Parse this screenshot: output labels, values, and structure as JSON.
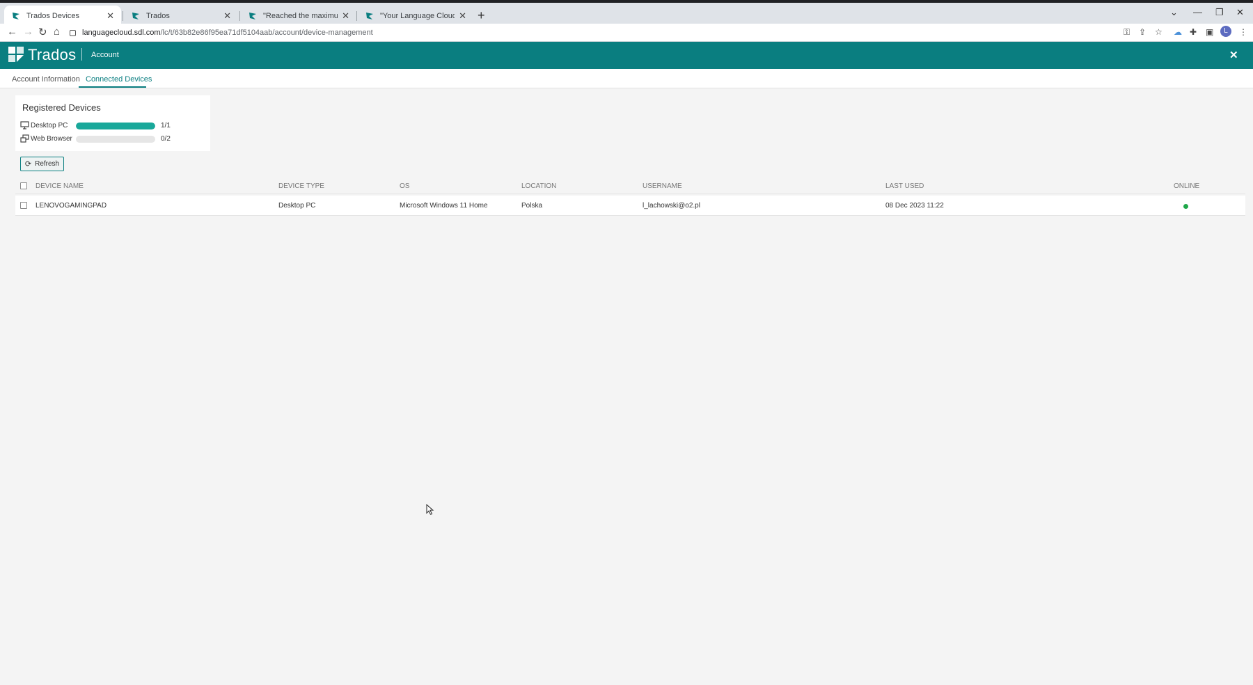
{
  "browser": {
    "tabs": [
      {
        "title": "Trados Devices",
        "active": true
      },
      {
        "title": "Trados",
        "active": false
      },
      {
        "title": "\"Reached the maximum allowe",
        "active": false
      },
      {
        "title": "\"Your Language Cloud account",
        "active": false
      }
    ],
    "url_host": "languagecloud.sdl.com",
    "url_path": "/lc/t/63b82e86f95ea71df5104aab/account/device-management",
    "profile_initial": "L"
  },
  "app": {
    "brand": "Trados",
    "section": "Account",
    "accent_color": "#0a7e80"
  },
  "subtabs": {
    "account_info": "Account Information",
    "connected_devices": "Connected Devices"
  },
  "registered": {
    "title": "Registered Devices",
    "rows": [
      {
        "label": "Desktop PC",
        "count": "1/1",
        "fraction": 1.0,
        "icon": "desktop-icon"
      },
      {
        "label": "Web Browser",
        "count": "0/2",
        "fraction": 0.0,
        "icon": "browser-windows-icon"
      }
    ]
  },
  "refresh_label": "Refresh",
  "table": {
    "headers": {
      "device_name": "DEVICE NAME",
      "device_type": "DEVICE TYPE",
      "os": "OS",
      "location": "LOCATION",
      "username": "USERNAME",
      "last_used": "LAST USED",
      "online": "ONLINE"
    },
    "rows": [
      {
        "device_name": "LENOVOGAMINGPAD",
        "device_type": "Desktop PC",
        "os": "Microsoft Windows 11 Home",
        "location": "Polska",
        "username": "l_lachowski@o2.pl",
        "last_used": "08 Dec 2023 11:22",
        "online": true
      }
    ]
  }
}
